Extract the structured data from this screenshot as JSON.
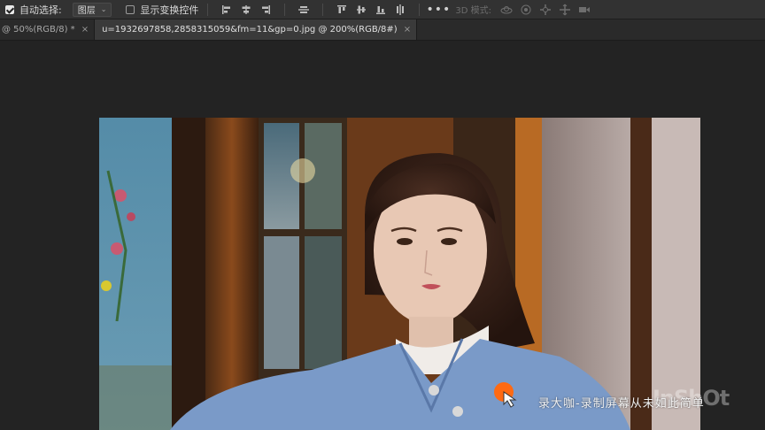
{
  "options_bar": {
    "auto_select_label": "自动选择:",
    "auto_select_checked": true,
    "auto_select_target": "图层",
    "show_transform_label": "显示变换控件",
    "show_transform_checked": false,
    "mode_3d_label": "3D 模式:"
  },
  "tabs": [
    {
      "label": "@ 50%(RGB/8) *",
      "active": false
    },
    {
      "label": "u=1932697858,2858315059&fm=11&gp=0.jpg @ 200%(RGB/8#)",
      "active": true
    }
  ],
  "overlay": {
    "watermark": "录大咖-录制屏幕从未如此简单",
    "logo": "InShOt",
    "cursor_color": "#ff6a13"
  }
}
